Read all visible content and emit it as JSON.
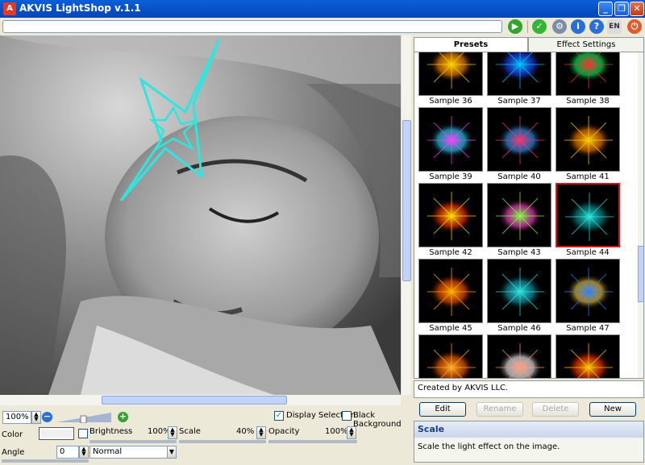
{
  "window": {
    "title": "AKVIS LightShop v.1.1",
    "minimize": "_",
    "maximize": "❐",
    "close": "✕"
  },
  "toolbar": {
    "path_value": "",
    "language": "EN",
    "icons": [
      "play-icon",
      "apply-icon",
      "settings-icon",
      "info-icon",
      "help-icon",
      "language-icon",
      "power-icon"
    ]
  },
  "zoom": {
    "value": "100%",
    "zoom_out": "−",
    "zoom_in": "+"
  },
  "options": {
    "display_selection_label": "Display Selection",
    "display_selection_checked": true,
    "black_background_label": "Black Background",
    "black_background_checked": false
  },
  "controls": {
    "color_label": "Color",
    "brightness_label": "Brightness",
    "brightness_value": "100%",
    "scale_label": "Scale",
    "scale_value": "40%",
    "opacity_label": "Opacity",
    "opacity_value": "100%",
    "angle_label": "Angle",
    "angle_value": "0",
    "blend_mode": "Normal"
  },
  "tabs": {
    "presets": "Presets",
    "effect_settings": "Effect Settings"
  },
  "presets": [
    {
      "label": "Sample 36"
    },
    {
      "label": "Sample 37"
    },
    {
      "label": "Sample 38"
    },
    {
      "label": "Sample 39"
    },
    {
      "label": "Sample 40"
    },
    {
      "label": "Sample 41"
    },
    {
      "label": "Sample 42"
    },
    {
      "label": "Sample 43"
    },
    {
      "label": "Sample 44",
      "selected": true
    },
    {
      "label": "Sample 45"
    },
    {
      "label": "Sample 46"
    },
    {
      "label": "Sample 47"
    },
    {
      "label": ""
    },
    {
      "label": ""
    },
    {
      "label": ""
    }
  ],
  "info": {
    "created_by": "Created by AKVIS LLC."
  },
  "buttons": {
    "edit": "Edit",
    "rename": "Rename",
    "delete": "Delete",
    "new": "New"
  },
  "help": {
    "title": "Scale",
    "text": "Scale the light effect on the image."
  },
  "colors": {
    "accent": "#0a5fd8",
    "selected_border": "#e01010",
    "light_effect": "#2ee6e0"
  }
}
